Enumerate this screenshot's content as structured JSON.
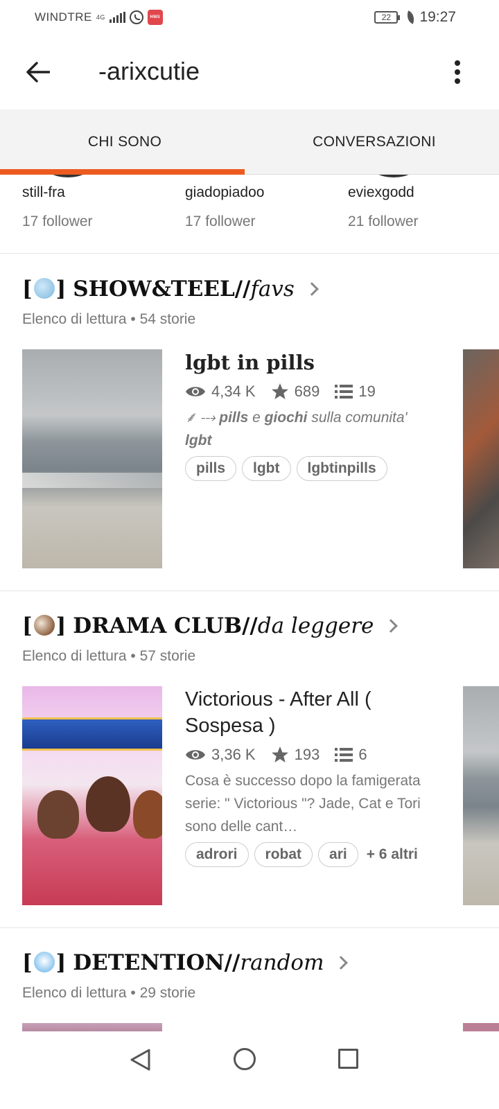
{
  "status_bar": {
    "carrier": "WINDTRE",
    "network": "4G",
    "battery": "22",
    "time": "19:27"
  },
  "header": {
    "title": "-arixcutie"
  },
  "tabs": [
    {
      "label": "CHI SONO",
      "active": true
    },
    {
      "label": "CONVERSAZIONI",
      "active": false
    }
  ],
  "accent_color": "#ec5a1f",
  "followers": [
    {
      "name": "still-fra",
      "count": "17 follower"
    },
    {
      "name": "giadopiadoo",
      "count": "17 follower"
    },
    {
      "name": "eviexgodd",
      "count": "21 follower"
    }
  ],
  "reading_lists": [
    {
      "bracket_open": "[",
      "bracket_close": "]",
      "emoji": "globe-icon",
      "title_bold": "SHOW&TEEL//",
      "title_italic": "favs",
      "subtitle": "Elenco di lettura • 54 storie",
      "story": {
        "title": "lgbt in pills",
        "views": "4,34 K",
        "votes": "689",
        "parts": "19",
        "desc_prefix": "⸙ ⤏ ",
        "desc_bold1": "pills",
        "desc_mid1": " e ",
        "desc_bold2": "giochi",
        "desc_mid2": " sulla comunita'",
        "desc_bold3": "lgbt",
        "tags": [
          "pills",
          "lgbt",
          "lgbtinpills"
        ],
        "more_tags": ""
      }
    },
    {
      "bracket_open": "[",
      "bracket_close": "]",
      "emoji": "shell-icon",
      "title_bold": "DRAMA CLUB//",
      "title_italic": "da leggere",
      "subtitle": "Elenco di lettura • 57 storie",
      "story": {
        "title": "Victorious - After All ( Sospesa )",
        "views": "3,36 K",
        "votes": "193",
        "parts": "6",
        "desc": "Cosa è successo dopo la famigerata serie: \" Victorious \"? Jade, Cat e Tori sono delle cant…",
        "tags": [
          "adrori",
          "robat",
          "ari"
        ],
        "more_tags": "+ 6 altri"
      }
    },
    {
      "bracket_open": "[",
      "bracket_close": "]",
      "emoji": "cloud-icon",
      "title_bold": "DETENTION//",
      "title_italic": "random",
      "subtitle": "Elenco di lettura • 29 storie"
    }
  ]
}
